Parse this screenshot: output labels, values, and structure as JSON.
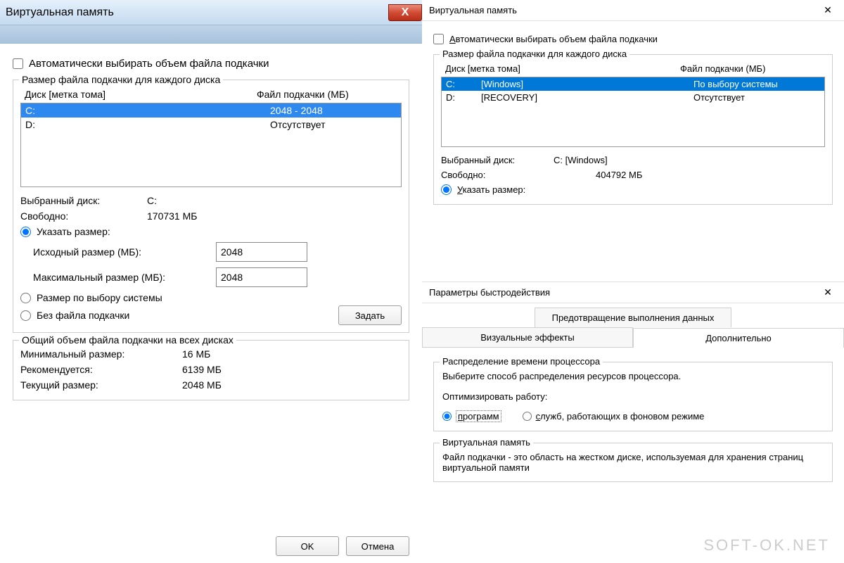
{
  "left": {
    "title": "Виртуальная память",
    "close_label": "X",
    "auto_checkbox": "Автоматически выбирать объем файла подкачки",
    "group_disk_title": "Размер файла подкачки для каждого диска",
    "col_disk": "Диск [метка тома]",
    "col_file": "Файл подкачки (МБ)",
    "rows": [
      {
        "drive": "C:",
        "label": "",
        "value": "2048 - 2048"
      },
      {
        "drive": "D:",
        "label": "",
        "value": "Отсутствует"
      }
    ],
    "selected_disk_label": "Выбранный диск:",
    "selected_disk_value": "C:",
    "free_label": "Свободно:",
    "free_value": "170731 МБ",
    "radio_custom": "Указать размер:",
    "initial_label": "Исходный размер (МБ):",
    "initial_value": "2048",
    "max_label": "Максимальный размер (МБ):",
    "max_value": "2048",
    "radio_system": "Размер по выбору системы",
    "radio_none": "Без файла подкачки",
    "set_button": "Задать",
    "group_total_title": "Общий объем файла подкачки на всех дисках",
    "min_label": "Минимальный размер:",
    "min_value": "16 МБ",
    "rec_label": "Рекомендуется:",
    "rec_value": "6139 МБ",
    "cur_label": "Текущий размер:",
    "cur_value": "2048 МБ",
    "ok_button": "OK",
    "cancel_button": "Отмена"
  },
  "right": {
    "title": "Виртуальная память",
    "auto_checkbox": "Автоматически выбирать объем файла подкачки",
    "auto_letter_prefix": "А",
    "auto_rest": "втоматически выбирать объем файла подкачки",
    "group_disk_title": "Размер файла подкачки для каждого диска",
    "col_disk_letter": "Д",
    "col_disk_rest": "иск [метка тома]",
    "col_file": "Файл подкачки (МБ)",
    "rows": [
      {
        "drive": "C:",
        "label": "[Windows]",
        "value": "По выбору системы"
      },
      {
        "drive": "D:",
        "label": "[RECOVERY]",
        "value": "Отсутствует"
      }
    ],
    "selected_disk_label": "Выбранный диск:",
    "selected_disk_value": "C: [Windows]",
    "free_label": "Свободно:",
    "free_value": "404792 МБ",
    "radio_custom_letter": "У",
    "radio_custom_rest": "казать размер:"
  },
  "perf": {
    "title": "Параметры быстродействия",
    "tab_dep": "Предотвращение выполнения данных",
    "tab_visual": "Визуальные эффекты",
    "tab_advanced": "Дополнительно",
    "group_cpu_title": "Распределение времени процессора",
    "cpu_desc": "Выберите способ распределения ресурсов процессора.",
    "optimize_label": "Оптимизировать работу:",
    "radio_programs_letter": "п",
    "radio_programs_rest": "рограмм",
    "radio_services_letter": "с",
    "radio_services_rest": "лужб, работающих в фоновом режиме",
    "group_vm_title": "Виртуальная память",
    "vm_desc": "Файл подкачки - это область на жестком диске, используемая для хранения страниц виртуальной памяти"
  },
  "watermark": "SOFT-OK.NET"
}
